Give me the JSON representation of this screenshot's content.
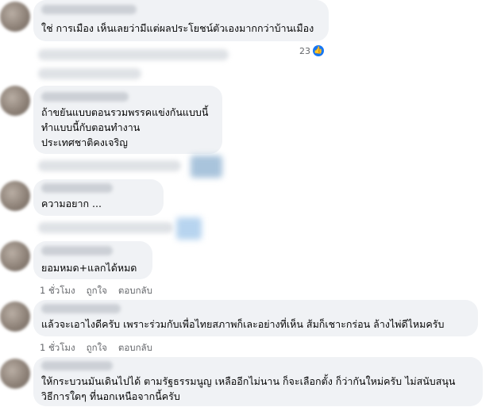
{
  "comments": [
    {
      "text": [
        "ใช่ การเมือง เห็นเลยว่ามีแต่ผลประโยชน์ตัวเองมากกว่าบ้านเมือง"
      ],
      "reactions": "23"
    },
    {
      "text": [
        "ถ้าขยันแบบตอนรวมพรรคแข่งกันแบบนี้",
        "ทำแบบนี้กับตอนทำงาน",
        "ประเทศชาติคงเจริญ"
      ]
    },
    {
      "text": [
        "ความอยาก ..."
      ]
    },
    {
      "text": [
        "ยอมหมด+แลกได้หมด"
      ],
      "time": "1 ชั่วโมง",
      "like": "ถูกใจ",
      "reply": "ตอบกลับ"
    },
    {
      "text": [
        "แล้วจะเอาไงดีครับ เพราะร่วมกับเพื่อไทยสภาพก็เละอย่างที่เห็น ส้มก็เชาะกร่อน ล้างไพ่ดีไหมครับ"
      ],
      "time": "1 ชั่วโมง",
      "like": "ถูกใจ",
      "reply": "ตอบกลับ"
    },
    {
      "text": [
        "ให้กระบวนมันเดินไปได้ ตามรัฐธรรมนูญ เหลืออีกไม่นาน ก็จะเลือกตั้ง ก็ว่ากันใหม่ครับ ไม่สนับสนุน",
        "วิธีการใดๆ ที่นอกเหนือจากนี้ครับ"
      ]
    }
  ],
  "colors": {
    "bubble": "#f0f2f5",
    "meta": "#65676b",
    "like_blue": "#1877f2"
  }
}
